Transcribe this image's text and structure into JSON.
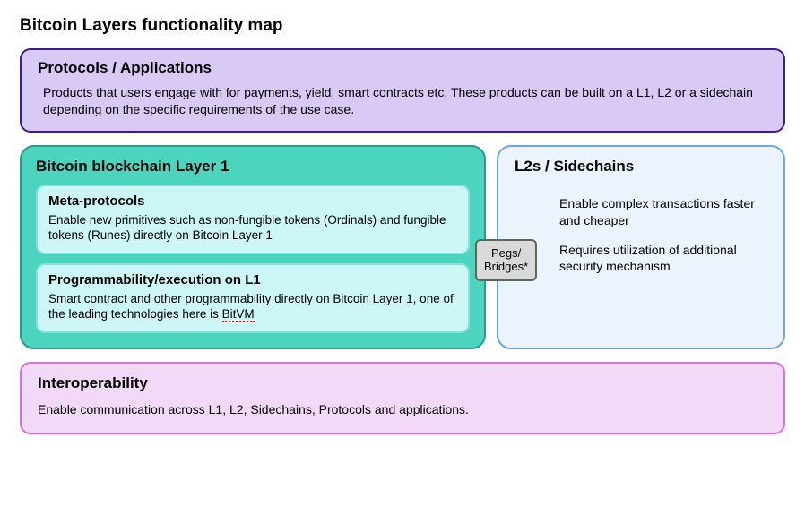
{
  "title": "Bitcoin Layers functionality map",
  "protocols": {
    "title": "Protocols / Applications",
    "desc": "Products that users engage with for payments, yield, smart contracts etc. These products can be built on a L1, L2  or  a sidechain depending on  the specific requirements of the use case."
  },
  "layer1": {
    "title": "Bitcoin blockchain Layer 1",
    "meta": {
      "title": "Meta-protocols",
      "desc": "Enable new primitives such as non-fungible tokens (Ordinals) and fungible tokens (Runes)  directly on Bitcoin Layer 1"
    },
    "prog": {
      "title": "Programmability/execution on L1",
      "desc_prefix": "Smart contract and other programmability directly on Bitcoin Layer 1, one of the leading technologies here is ",
      "desc_term": "BitVM"
    }
  },
  "pegs": {
    "line1": "Pegs/",
    "line2": "Bridges*"
  },
  "l2": {
    "title": "L2s / Sidechains",
    "desc1": "Enable complex transactions faster and cheaper",
    "desc2": "Requires utilization of additional security mechanism"
  },
  "interop": {
    "title": "Interoperability",
    "desc": "Enable communication across L1, L2, Sidechains, Protocols and applications."
  }
}
